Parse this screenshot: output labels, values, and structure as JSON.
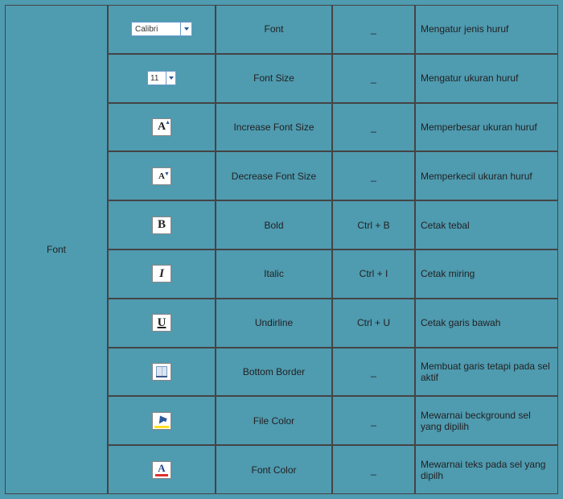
{
  "group_label": "Font",
  "rows": [
    {
      "icon": "font-select-dropdown",
      "icon_value": "Calibri",
      "name": "Font",
      "shortcut": "_",
      "desc": "Mengatur jenis huruf"
    },
    {
      "icon": "font-size-dropdown",
      "icon_value": "11",
      "name": "Font Size",
      "shortcut": "_",
      "desc": "Mengatur ukuran huruf"
    },
    {
      "icon": "increase-font-icon",
      "name": "Increase Font Size",
      "shortcut": "_",
      "desc": "Memperbesar ukuran huruf"
    },
    {
      "icon": "decrease-font-icon",
      "name": "Decrease Font Size",
      "shortcut": "_",
      "desc": "Memperkecil ukuran huruf"
    },
    {
      "icon": "bold-icon",
      "name": "Bold",
      "shortcut": "Ctrl + B",
      "desc": "Cetak tebal"
    },
    {
      "icon": "italic-icon",
      "name": "Italic",
      "shortcut": "Ctrl + I",
      "desc": "Cetak miring"
    },
    {
      "icon": "underline-icon",
      "name": "Undirline",
      "shortcut": "Ctrl + U",
      "desc": "Cetak garis bawah"
    },
    {
      "icon": "bottom-border-icon",
      "name": "Bottom Border",
      "shortcut": "_",
      "desc": "Membuat garis tetapi pada sel aktif"
    },
    {
      "icon": "fill-color-icon",
      "name": "File Color",
      "shortcut": "_",
      "desc": " Mewarnai beckground sel yang dipilih"
    },
    {
      "icon": "font-color-icon",
      "name": "Font Color",
      "shortcut": "_",
      "desc": "Mewarnai teks pada sel yang dipilh"
    }
  ]
}
